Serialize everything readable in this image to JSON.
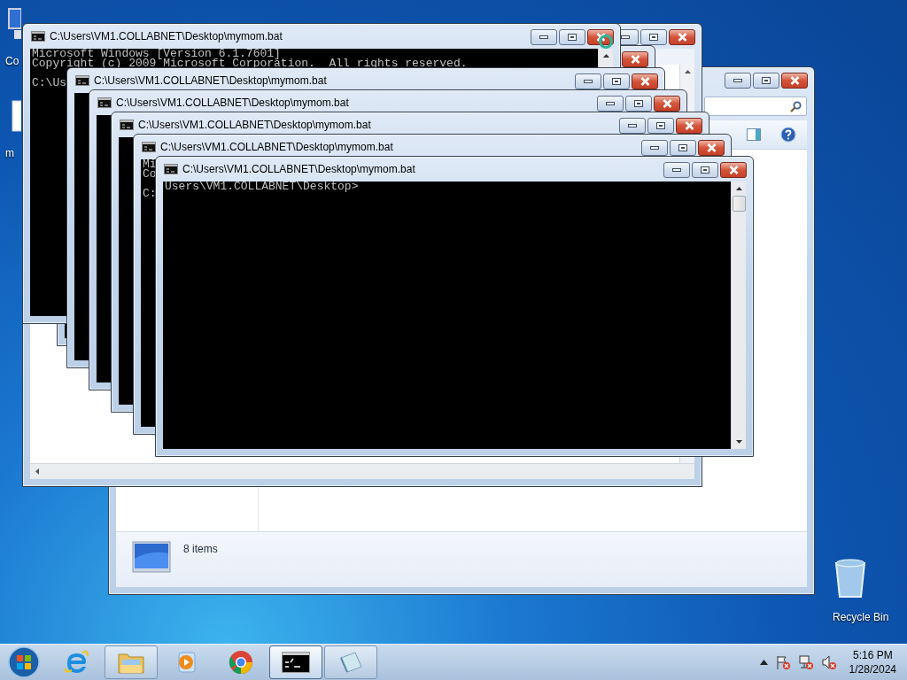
{
  "desktop_icons": [
    {
      "kind": "computer",
      "label": "Co"
    },
    {
      "kind": "document",
      "label": "m"
    },
    {
      "kind": "recycle-bin",
      "label": "Recycle Bin"
    }
  ],
  "windows": [
    {
      "kind": "explorer",
      "status": "8 items"
    },
    {
      "kind": "viewer"
    },
    {
      "kind": "console"
    },
    {
      "kind": "console",
      "title": "C:\\Users\\VM1.COLLABNET\\Desktop\\mymom.bat",
      "blocks": [
        [
          "Microsoft Windows [Version 6.1.7601]",
          "Copyright (c) 2009 Microsoft Corporation.  All rights reserved."
        ],
        [
          "C:\\Us"
        ]
      ]
    },
    {
      "kind": "console",
      "title": "C:\\Users\\VM1.COLLABNET\\Desktop\\mymom.bat"
    },
    {
      "kind": "console",
      "title": "C:\\Users\\VM1.COLLABNET\\Desktop\\mymom.bat"
    },
    {
      "kind": "console",
      "title": "C:\\Users\\VM1.COLLABNET\\Desktop\\mymom.bat"
    },
    {
      "kind": "console",
      "title": "C:\\Users\\VM1.COLLABNET\\Desktop\\mymom.bat",
      "blocks": [
        [
          "Mi",
          "Co"
        ],
        [
          "C:"
        ]
      ]
    },
    {
      "kind": "console",
      "title": "C:\\Users\\VM1.COLLABNET\\Desktop\\mymom.bat",
      "blocks": [
        [
          "Users\\VM1.COLLABNET\\Desktop>"
        ]
      ]
    }
  ],
  "taskbar": {
    "buttons": [
      {
        "kind": "browser-e",
        "running": false,
        "selected": false
      },
      {
        "kind": "folders",
        "running": true,
        "selected": false
      },
      {
        "kind": "media",
        "running": false,
        "selected": false
      },
      {
        "kind": "chrome",
        "running": false,
        "selected": false
      },
      {
        "kind": "console",
        "running": true,
        "selected": true
      },
      {
        "kind": "notepad",
        "running": true,
        "selected": false
      }
    ],
    "tray": [
      {
        "kind": "arrow"
      },
      {
        "kind": "flag"
      },
      {
        "kind": "network"
      },
      {
        "kind": "speaker"
      }
    ],
    "clock": {
      "time": "5:16 PM",
      "date": "1/28/2024"
    }
  }
}
